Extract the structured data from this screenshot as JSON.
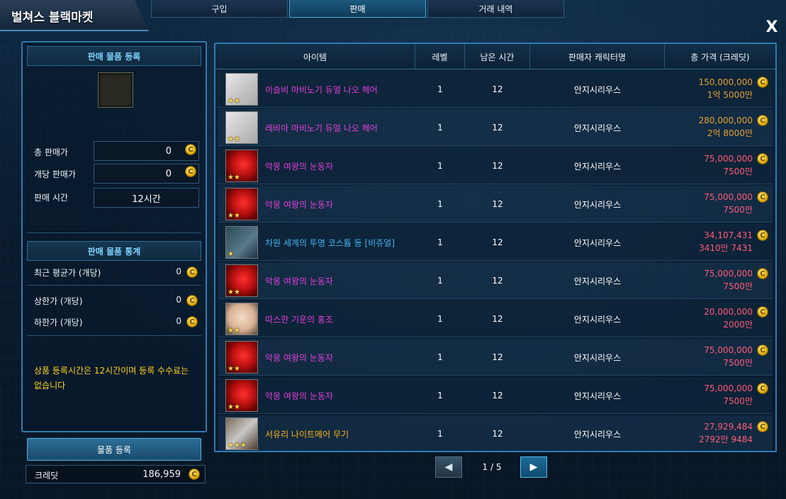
{
  "window": {
    "title": "벌쳐스 블랙마켓",
    "close_symbol": "X"
  },
  "tabs": [
    {
      "label": "구입",
      "active": false
    },
    {
      "label": "판매",
      "active": true
    },
    {
      "label": "거래 내역",
      "active": false
    }
  ],
  "left": {
    "register_header": "판매 물품 등록",
    "total_price_label": "총 판매가",
    "total_price_value": "0",
    "unit_price_label": "개당 판매가",
    "unit_price_value": "0",
    "sell_time_label": "판매 시간",
    "sell_time_value": "12시간",
    "stats_header": "판매 물품 통계",
    "recent_avg_label": "최근 평균가 (개당)",
    "recent_avg_value": "0",
    "upper_limit_label": "상한가 (개당)",
    "upper_limit_value": "0",
    "lower_limit_label": "하한가 (개당)",
    "lower_limit_value": "0",
    "notice": "상품 등록시간은 12시간이며 등록 수수료는 없습니다",
    "register_button": "물품 등록",
    "credit_label": "크레딧",
    "credit_value": "186,959",
    "coin_symbol": "C"
  },
  "table": {
    "headers": {
      "item": "아이템",
      "level": "레벨",
      "time_left": "남은 시간",
      "seller": "판매자 캐릭터명",
      "total_price": "총 가격 (크레딧)"
    },
    "rows": [
      {
        "name": "이슬비 마비노기 듀얼 나오 헤어",
        "name_color": "#e040d8",
        "thumb": "white",
        "stars": "★★",
        "level": "1",
        "time": "12",
        "seller": "안지시리우스",
        "price": "150,000,000",
        "price_sub": "1억 5000만",
        "price_color": "#e3a032"
      },
      {
        "name": "레비아 마비노기 듀얼 나오 헤어",
        "name_color": "#e040d8",
        "thumb": "white",
        "stars": "★★",
        "level": "1",
        "time": "12",
        "seller": "안지시리우스",
        "price": "280,000,000",
        "price_sub": "2억 8000만",
        "price_color": "#e3a032"
      },
      {
        "name": "악몽 여왕의 눈동자",
        "name_color": "#e040d8",
        "thumb": "red",
        "stars": "★★",
        "level": "1",
        "time": "12",
        "seller": "안지시리우스",
        "price": "75,000,000",
        "price_sub": "7500만",
        "price_color": "#ff5a7a"
      },
      {
        "name": "악몽 여왕의 눈동자",
        "name_color": "#e040d8",
        "thumb": "red",
        "stars": "★★",
        "level": "1",
        "time": "12",
        "seller": "안지시리우스",
        "price": "75,000,000",
        "price_sub": "7500만",
        "price_color": "#ff5a7a"
      },
      {
        "name": "차원 세계의 투명 코스튬 등 [비쥬얼]",
        "name_color": "#3fb8f0",
        "thumb": "blue",
        "stars": "★",
        "level": "1",
        "time": "12",
        "seller": "안지시리우스",
        "price": "34,107,431",
        "price_sub": "3410만 7431",
        "price_color": "#ff5a7a"
      },
      {
        "name": "악몽 여왕의 눈동자",
        "name_color": "#e040d8",
        "thumb": "red",
        "stars": "★★",
        "level": "1",
        "time": "12",
        "seller": "안지시리우스",
        "price": "75,000,000",
        "price_sub": "7500만",
        "price_color": "#ff5a7a"
      },
      {
        "name": "따스한 기운의 홍조",
        "name_color": "#e040d8",
        "thumb": "face",
        "stars": "★★",
        "level": "1",
        "time": "12",
        "seller": "안지시리우스",
        "price": "20,000,000",
        "price_sub": "2000만",
        "price_color": "#ff5a7a"
      },
      {
        "name": "악몽 여왕의 눈동자",
        "name_color": "#e040d8",
        "thumb": "red",
        "stars": "★★",
        "level": "1",
        "time": "12",
        "seller": "안지시리우스",
        "price": "75,000,000",
        "price_sub": "7500만",
        "price_color": "#ff5a7a"
      },
      {
        "name": "악몽 여왕의 눈동자",
        "name_color": "#e040d8",
        "thumb": "red",
        "stars": "★★",
        "level": "1",
        "time": "12",
        "seller": "안지시리우스",
        "price": "75,000,000",
        "price_sub": "7500만",
        "price_color": "#ff5a7a"
      },
      {
        "name": "서유리 나이트메어 무기",
        "name_color": "#ffb21e",
        "thumb": "gun",
        "stars": "★★★",
        "level": "1",
        "time": "12",
        "seller": "안지시리우스",
        "price": "27,929,484",
        "price_sub": "2792만 9484",
        "price_color": "#ff5a7a"
      }
    ]
  },
  "pager": {
    "prev_symbol": "◀",
    "next_symbol": "▶",
    "text": "1 / 5"
  }
}
